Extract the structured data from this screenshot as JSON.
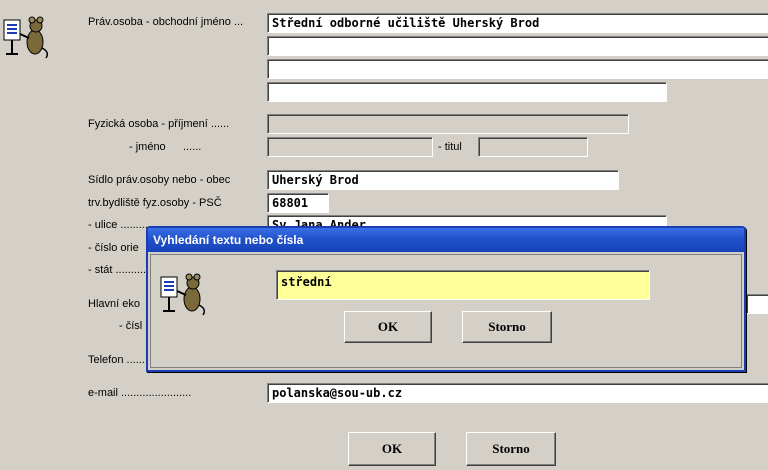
{
  "form": {
    "labels": {
      "company_name": "Práv.osoba - obchodní jméno ...",
      "surname": "Fyzická osoba - příjmení ......",
      "first_name": "- jméno",
      "first_name_dots": "......",
      "title": "- titul",
      "city": "Sídlo práv.osoby nebo  - obec",
      "zip": "trv.bydliště fyz.osoby - PSČ",
      "street": "- ulice .........",
      "number": "- číslo orie",
      "country": "- stát ..........",
      "main_econ": "Hlavní eko",
      "main_econ_sub": "- čísl",
      "phone": "Telefon ......",
      "email": "e-mail ......................."
    },
    "values": {
      "company_name_1": "Střední odborné učiliště Uherský Brod",
      "company_name_2": "",
      "company_name_3": "",
      "company_name_4": "",
      "surname": "",
      "first_name": "",
      "title": "",
      "city": "Uherský Brod",
      "zip": "68801",
      "street": "Sv.Jana Ander",
      "email": "polanska@sou-ub.cz"
    },
    "buttons": {
      "ok": "OK",
      "cancel": "Storno"
    }
  },
  "dialog": {
    "title": "Vyhledání textu nebo čísla",
    "search_value": "střední",
    "buttons": {
      "ok": "OK",
      "cancel": "Storno"
    }
  },
  "colors": {
    "background": "#d4d0c8",
    "titlebar": "#1f4fc9",
    "search_highlight": "#ffff99"
  }
}
